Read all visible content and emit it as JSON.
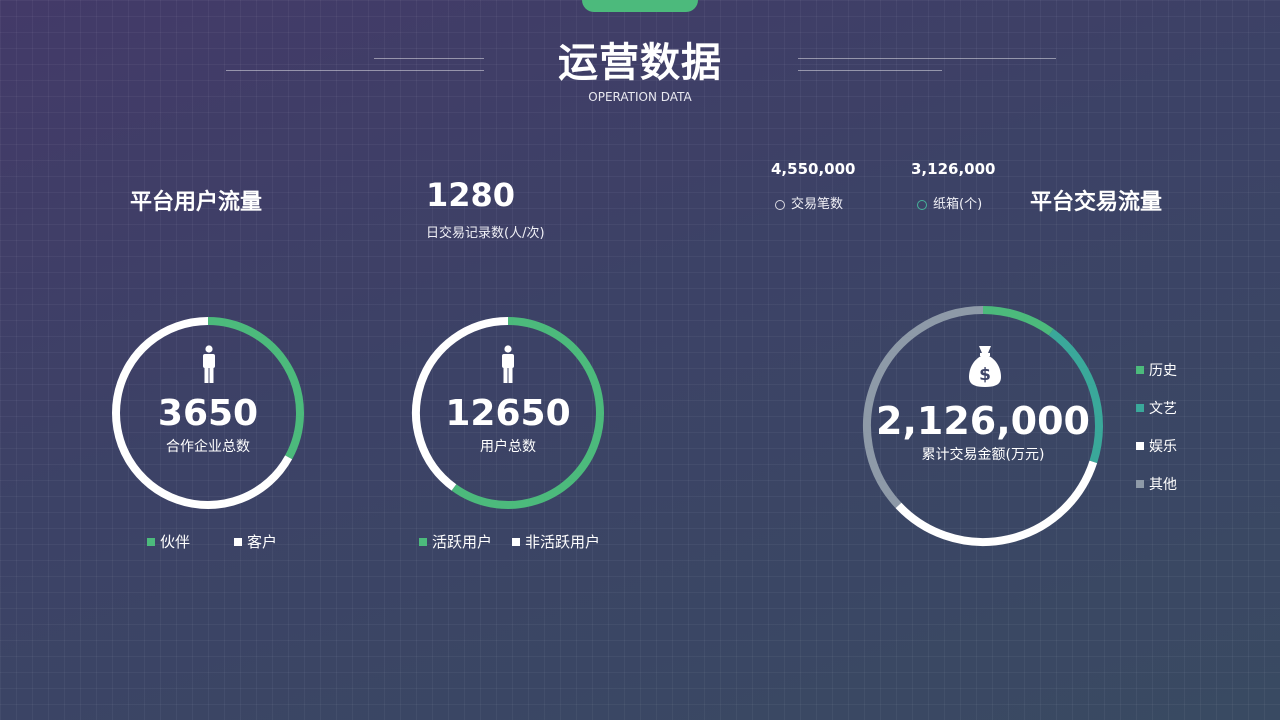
{
  "header": {
    "title": "运营数据",
    "subtitle": "OPERATION DATA"
  },
  "left_section": {
    "title": "平台用户流量"
  },
  "daily": {
    "value": "1280",
    "label": "日交易记录数(人/次)"
  },
  "stats": [
    {
      "value": "4,550,000",
      "label": "交易笔数",
      "marker_color": "#d8d8e0"
    },
    {
      "value": "3,126,000",
      "label": "纸箱(个)",
      "marker_color": "#46b39a"
    }
  ],
  "right_section": {
    "title": "平台交易流量"
  },
  "ring1": {
    "value": "3650",
    "label": "合作企业总数",
    "icon": "person-icon",
    "segments": [
      {
        "name": "伙伴",
        "fraction": 0.33,
        "color": "#4cba7c"
      },
      {
        "name": "客户",
        "fraction": 0.67,
        "color": "#ffffff"
      }
    ],
    "legend": [
      "伙伴",
      "客户"
    ]
  },
  "ring2": {
    "value": "12650",
    "label": "用户总数",
    "icon": "person-icon",
    "segments": [
      {
        "name": "活跃用户",
        "fraction": 0.6,
        "color": "#4cba7c"
      },
      {
        "name": "非活跃用户",
        "fraction": 0.4,
        "color": "#ffffff"
      }
    ],
    "legend": [
      "活跃用户",
      "非活跃用户"
    ]
  },
  "ring3": {
    "value": "2,126,000",
    "label": "累计交易金额(万元)",
    "icon": "money-bag-icon",
    "segments": [
      {
        "name": "历史",
        "fraction": 0.1,
        "color": "#4cba7c"
      },
      {
        "name": "文艺",
        "fraction": 0.2,
        "color": "#3aa89a"
      },
      {
        "name": "娱乐",
        "fraction": 0.33,
        "color": "#ffffff"
      },
      {
        "name": "其他",
        "fraction": 0.37,
        "color": "#8e9aa8"
      }
    ],
    "legend": [
      "历史",
      "文艺",
      "娱乐",
      "其他"
    ]
  }
}
